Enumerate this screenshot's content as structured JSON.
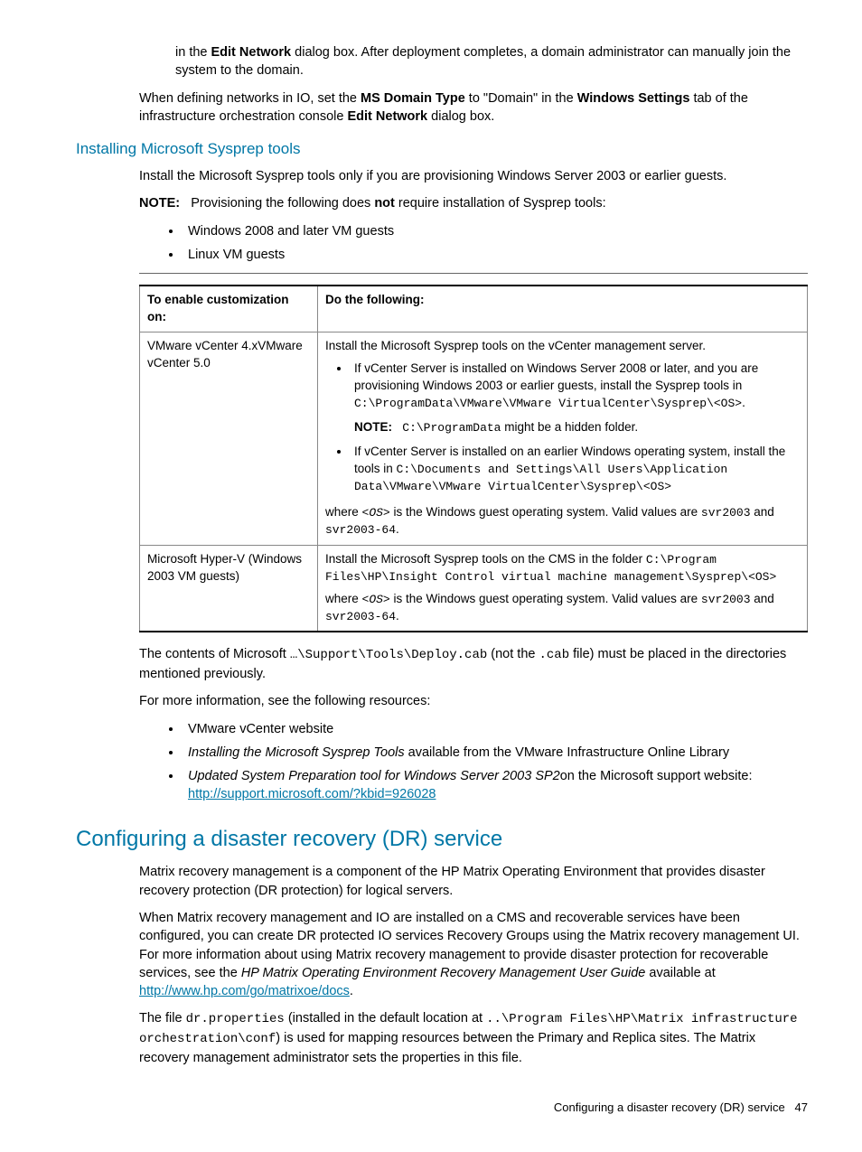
{
  "intro": {
    "p1_pre": "in the ",
    "p1_b1": "Edit Network",
    "p1_post": " dialog box. After deployment completes, a domain administrator can manually join the system to the domain.",
    "p2_pre": "When defining networks in IO, set the ",
    "p2_b1": "MS Domain Type",
    "p2_mid1": " to \"Domain\" in the ",
    "p2_b2": "Windows Settings",
    "p2_mid2": " tab of the infrastructure orchestration console ",
    "p2_b3": "Edit Network",
    "p2_end": " dialog box."
  },
  "sysprep": {
    "heading": "Installing Microsoft Sysprep tools",
    "p1": "Install the Microsoft Sysprep tools only if you are provisioning Windows Server 2003 or earlier guests.",
    "note_label": "NOTE:",
    "note_pre": "Provisioning the following does ",
    "note_b": "not",
    "note_post": " require installation of Sysprep tools:",
    "bullets": [
      "Windows 2008 and later VM guests",
      "Linux VM guests"
    ]
  },
  "table": {
    "h1": "To enable customization on:",
    "h2": "Do the following:",
    "r1c1": "VMware vCenter 4.xVMware vCenter 5.0",
    "r1": {
      "p1": "Install the Microsoft Sysprep tools on the vCenter management server.",
      "b1_pre": "If vCenter Server is installed on Windows Server 2008 or later, and you are provisioning Windows 2003 or earlier guests, install the Sysprep tools in ",
      "b1_code": "C:\\ProgramData\\VMware\\VMware VirtualCenter\\Sysprep\\<OS>",
      "b1_dot": ".",
      "note_label": "NOTE:",
      "note_code": "C:\\ProgramData",
      "note_post": " might be a hidden folder.",
      "b2_pre": "If vCenter Server is installed on an earlier Windows operating system, install the tools in ",
      "b2_code": "C:\\Documents and Settings\\All Users\\Application Data\\VMware\\VMware VirtualCenter\\Sysprep\\<OS>",
      "where_pre": "where ",
      "where_os": "<OS>",
      "where_mid": " is the Windows guest operating system. Valid values are ",
      "where_v1": "svr2003",
      "where_and": " and ",
      "where_v2": "svr2003-64",
      "where_dot": "."
    },
    "r2c1": "Microsoft Hyper-V (Windows 2003 VM guests)",
    "r2": {
      "p1_pre": "Install the Microsoft Sysprep tools on the CMS in the folder ",
      "p1_code": "C:\\Program Files\\HP\\Insight Control virtual machine management\\Sysprep\\<OS>",
      "where_pre": "where ",
      "where_os": "<OS>",
      "where_mid": " is the Windows guest operating system. Valid values are ",
      "where_v1": "svr2003",
      "where_and": " and ",
      "where_v2": "svr2003-64",
      "where_dot": "."
    }
  },
  "after_table": {
    "p1_pre": "The contents of Microsoft ",
    "p1_code1": "…\\Support\\Tools\\Deploy.cab",
    "p1_mid": " (not the ",
    "p1_code2": ".cab",
    "p1_post": " file) must be placed in the directories mentioned previously.",
    "p2": "For more information, see the following resources:",
    "b1": "VMware vCenter website",
    "b2_i": "Installing the Microsoft Sysprep Tools",
    "b2_post": " available from the VMware Infrastructure Online Library",
    "b3_i": "Updated System Preparation tool for Windows Server 2003 SP2",
    "b3_post": "on the Microsoft support website:",
    "b3_link": "http://support.microsoft.com/?kbid=926028"
  },
  "dr": {
    "heading": "Configuring a disaster recovery (DR) service",
    "p1": "Matrix recovery management is a component of the HP Matrix Operating Environment that provides disaster recovery protection (DR protection) for logical servers.",
    "p2_pre": "When Matrix recovery management and IO are installed on a CMS and recoverable services have been configured, you can create DR protected IO services Recovery Groups using the Matrix recovery management UI. For more information about using Matrix recovery management to provide disaster protection for recoverable services, see the ",
    "p2_i": "HP Matrix Operating Environment Recovery Management User Guide",
    "p2_mid": " available at ",
    "p2_link": "http://www.hp.com/go/matrixoe/docs",
    "p2_dot": ".",
    "p3_pre": "The file ",
    "p3_code1": "dr.properties",
    "p3_mid1": " (installed in the default location at ",
    "p3_code2": "..\\Program Files\\HP\\Matrix infrastructure orchestration\\conf",
    "p3_post": ") is used for mapping resources between the Primary and Replica sites. The Matrix recovery management administrator sets the properties in this file."
  },
  "footer": {
    "text": "Configuring a disaster recovery (DR) service",
    "page": "47"
  }
}
